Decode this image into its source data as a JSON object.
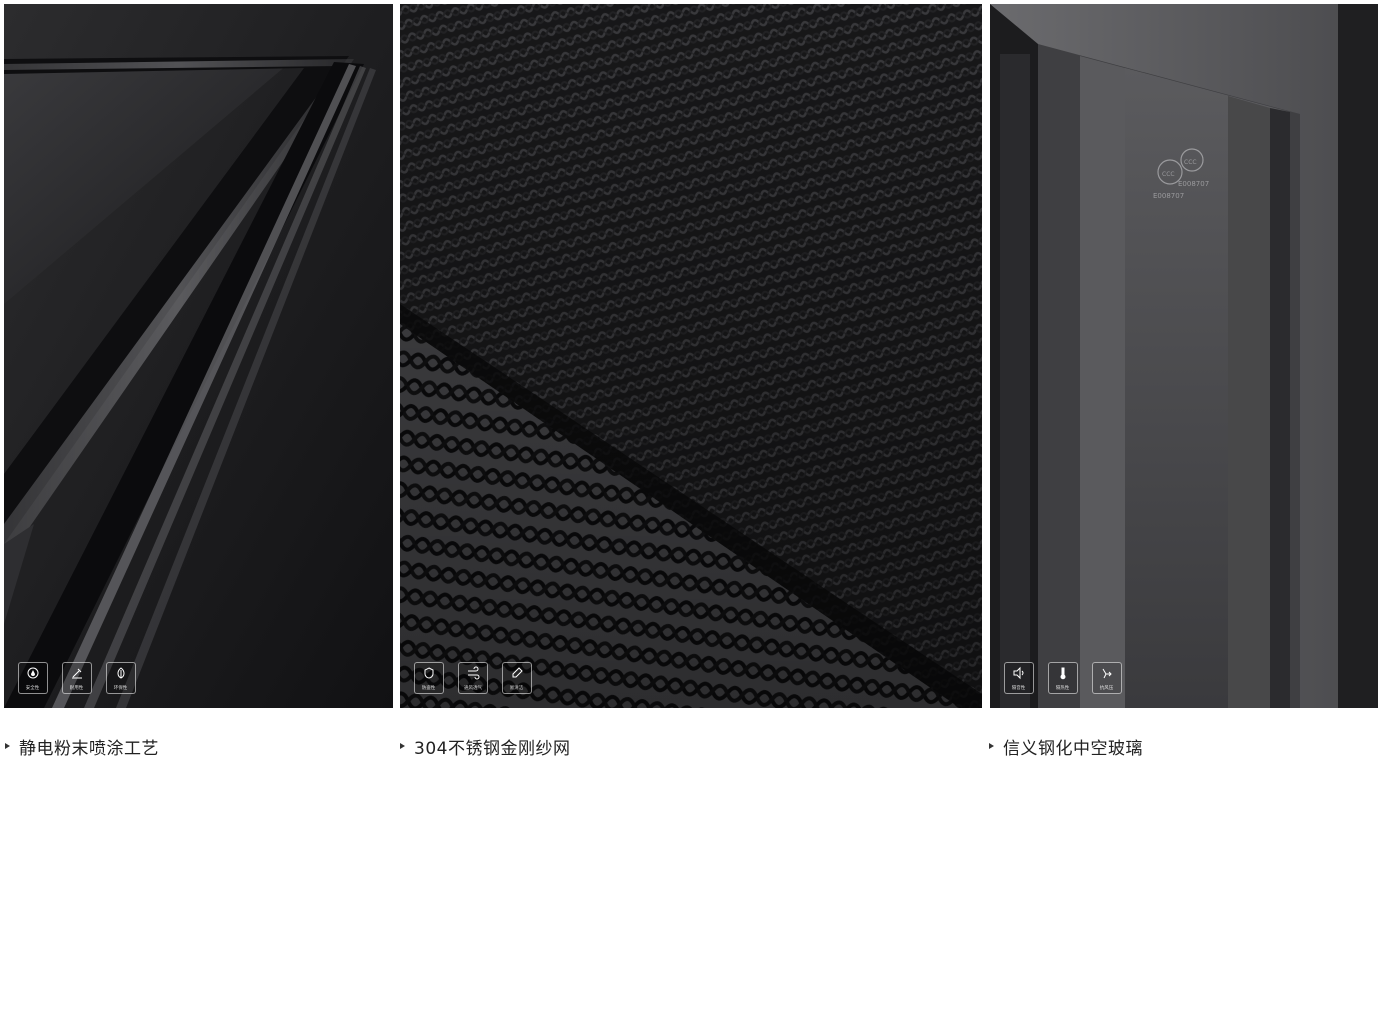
{
  "panels": [
    {
      "id": "powder-coating",
      "caption": "静电粉末喷涂工艺",
      "badges": [
        {
          "icon": "droplet-icon",
          "label": "安全性"
        },
        {
          "icon": "tool-icon",
          "label": "耐用性"
        },
        {
          "icon": "leaf-icon",
          "label": "环保性"
        }
      ]
    },
    {
      "id": "steel-mesh",
      "caption": "304不锈钢金刚纱网",
      "badges": [
        {
          "icon": "shield-icon",
          "label": "防盗性"
        },
        {
          "icon": "wind-icon",
          "label": "通风透气"
        },
        {
          "icon": "brush-icon",
          "label": "易清洁"
        }
      ]
    },
    {
      "id": "tempered-glass",
      "caption": "信义钢化中空玻璃",
      "badges": [
        {
          "icon": "speaker-icon",
          "label": "隔音性"
        },
        {
          "icon": "thermometer-icon",
          "label": "隔热性"
        },
        {
          "icon": "wind-pressure-icon",
          "label": "抗风压"
        }
      ]
    }
  ],
  "glass_marks": {
    "certification": "CCC",
    "code_1": "E008707",
    "code_2": "E008707"
  },
  "colors": {
    "panel_dark": "#1a1a1c",
    "caption_text": "#222222",
    "background": "#ffffff"
  }
}
